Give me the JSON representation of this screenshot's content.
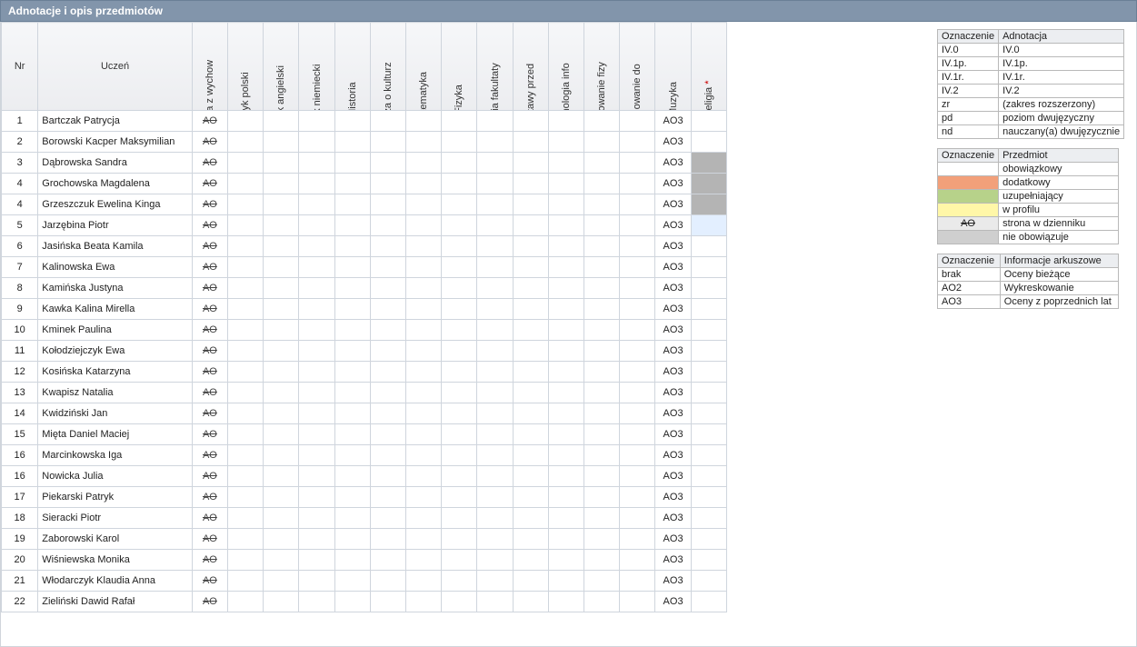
{
  "header": {
    "title": "Adnotacje i opis przedmiotów"
  },
  "columns": {
    "nr": "Nr",
    "student": "Uczeń",
    "subjects": [
      "Zajęcia z wychow",
      "Język polski",
      "Język angielski",
      "Język niemiecki",
      "Historia",
      "Wiedza o kulturz",
      "Matematyka",
      "Fizyka",
      "Zajęcia fakultaty",
      "Podstawy przed",
      "Technologia info",
      "Wychowanie fizy",
      "Wychowanie do",
      "Muzyka",
      "Religia"
    ],
    "religia_star": "*",
    "ao_label": "AO",
    "ao3_label": "AO3"
  },
  "students": [
    {
      "nr": 1,
      "name": "Bartczak Patrycja",
      "religia": ""
    },
    {
      "nr": 2,
      "name": "Borowski Kacper Maksymilian",
      "religia": ""
    },
    {
      "nr": 3,
      "name": "Dąbrowska Sandra",
      "religia": "dark"
    },
    {
      "nr": 4,
      "name": "Grochowska Magdalena",
      "religia": "dark"
    },
    {
      "nr": 4,
      "name": "Grzeszczuk Ewelina Kinga",
      "religia": "dark"
    },
    {
      "nr": 5,
      "name": "Jarzębina Piotr",
      "religia": "light"
    },
    {
      "nr": 6,
      "name": "Jasińska Beata Kamila",
      "religia": ""
    },
    {
      "nr": 7,
      "name": "Kalinowska Ewa",
      "religia": ""
    },
    {
      "nr": 8,
      "name": "Kamińska Justyna",
      "religia": ""
    },
    {
      "nr": 9,
      "name": "Kawka Kalina Mirella",
      "religia": ""
    },
    {
      "nr": 10,
      "name": "Kminek Paulina",
      "religia": ""
    },
    {
      "nr": 11,
      "name": "Kołodziejczyk Ewa",
      "religia": ""
    },
    {
      "nr": 12,
      "name": "Kosińska Katarzyna",
      "religia": ""
    },
    {
      "nr": 13,
      "name": "Kwapisz Natalia",
      "religia": ""
    },
    {
      "nr": 14,
      "name": "Kwidziński Jan",
      "religia": ""
    },
    {
      "nr": 15,
      "name": "Mięta Daniel Maciej",
      "religia": ""
    },
    {
      "nr": 16,
      "name": "Marcinkowska Iga",
      "religia": ""
    },
    {
      "nr": 16,
      "name": "Nowicka Julia",
      "religia": ""
    },
    {
      "nr": 17,
      "name": "Piekarski Patryk",
      "religia": ""
    },
    {
      "nr": 18,
      "name": "Sieracki Piotr",
      "religia": ""
    },
    {
      "nr": 19,
      "name": "Zaborowski Karol",
      "religia": ""
    },
    {
      "nr": 20,
      "name": "Wiśniewska Monika",
      "religia": ""
    },
    {
      "nr": 21,
      "name": "Włodarczyk Klaudia Anna",
      "religia": ""
    },
    {
      "nr": 22,
      "name": "Zieliński Dawid Rafał",
      "religia": ""
    }
  ],
  "legend_annotation": {
    "head_ozn": "Oznaczenie",
    "head_ad": "Adnotacja",
    "rows": [
      {
        "ozn": "IV.0",
        "ad": "IV.0"
      },
      {
        "ozn": "IV.1p.",
        "ad": "IV.1p."
      },
      {
        "ozn": "IV.1r.",
        "ad": "IV.1r."
      },
      {
        "ozn": "IV.2",
        "ad": "IV.2"
      },
      {
        "ozn": "zr",
        "ad": "(zakres rozszerzony)"
      },
      {
        "ozn": "pd",
        "ad": "poziom dwujęzyczny"
      },
      {
        "ozn": "nd",
        "ad": "nauczany(a) dwujęzycznie"
      }
    ]
  },
  "legend_subject": {
    "head_ozn": "Oznaczenie",
    "head_pr": "Przedmiot",
    "ao_label": "AO",
    "rows": [
      {
        "class": "sw-obow",
        "label": "obowiązkowy"
      },
      {
        "class": "sw-dodat",
        "label": "dodatkowy"
      },
      {
        "class": "sw-uzup",
        "label": "uzupełniający"
      },
      {
        "class": "sw-profil",
        "label": "w profilu"
      },
      {
        "class": "sw-strona",
        "label": "strona w dzienniku"
      },
      {
        "class": "sw-nieobo",
        "label": "nie obowiązuje"
      }
    ]
  },
  "legend_sheet": {
    "head_ozn": "Oznaczenie",
    "head_inf": "Informacje arkuszowe",
    "rows": [
      {
        "ozn": "brak",
        "inf": "Oceny bieżące"
      },
      {
        "ozn": "AO2",
        "inf": "Wykreskowanie"
      },
      {
        "ozn": "AO3",
        "inf": "Oceny z poprzednich lat"
      }
    ]
  }
}
